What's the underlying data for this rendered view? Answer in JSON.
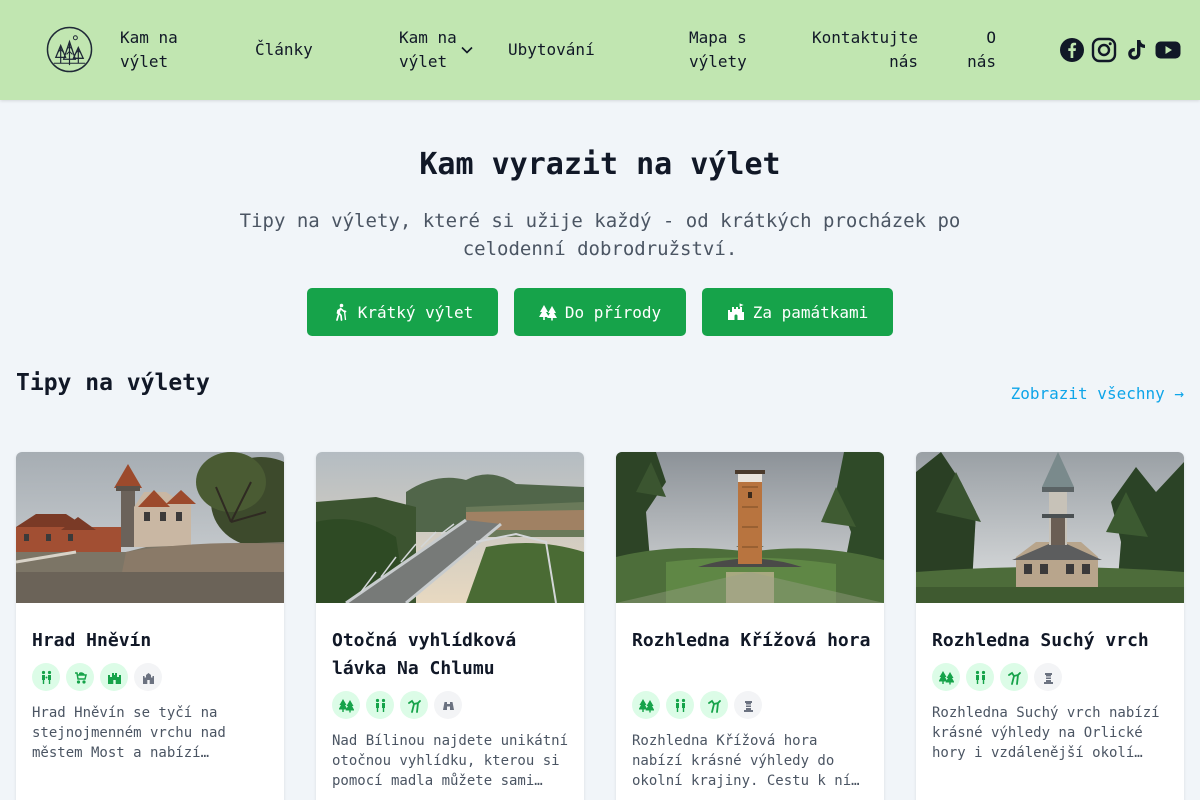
{
  "header": {
    "nav": [
      {
        "line1": "Kam na",
        "line2": "výlet"
      },
      {
        "line1": "Články",
        "line2": ""
      },
      {
        "line1": "Kam na",
        "line2": "výlet"
      },
      {
        "line1": "Ubytování",
        "line2": ""
      },
      {
        "line1": "Mapa s",
        "line2": "výlety"
      },
      {
        "line1": "Kontaktujte",
        "line2": "nás"
      },
      {
        "line1": "O",
        "line2": "nás"
      }
    ],
    "social": [
      "facebook-icon",
      "instagram-icon",
      "tiktok-icon",
      "youtube-icon"
    ]
  },
  "hero": {
    "title": "Kam vyrazit na výlet",
    "subtitle_line1": "Tipy na výlety, které si užije každý - od krátkých procházek po",
    "subtitle_line2": "celodenní dobrodružství.",
    "buttons": [
      {
        "label": "Krátký výlet",
        "icon": "hiker-icon"
      },
      {
        "label": "Do přírody",
        "icon": "trees-icon"
      },
      {
        "label": "Za památkami",
        "icon": "castle-icon"
      }
    ]
  },
  "section": {
    "title": "Tipy na výlety",
    "show_all": "Zobrazit všechny →"
  },
  "cards": [
    {
      "title": "Hrad Hněvín",
      "tags": [
        "family-icon",
        "stroller-icon",
        "castle-icon",
        "castle-icon"
      ],
      "desc": [
        "Hrad Hněvín se tyčí na",
        "stejnojmenném vrchu nad",
        "městem Most a nabízí…"
      ]
    },
    {
      "title": "Otočná vyhlídková lávka Na Chlumu",
      "tags": [
        "trees-icon",
        "family-icon",
        "bike-icon",
        "binoculars-icon"
      ],
      "desc": [
        "Nad Bílinou najdete unikátní",
        "otočnou vyhlídku, kterou si",
        "pomocí madla můžete sami…"
      ]
    },
    {
      "title": "Rozhledna Křížová hora",
      "tags": [
        "trees-icon",
        "family-icon",
        "bike-icon",
        "tower-icon"
      ],
      "desc": [
        "Rozhledna Křížová hora",
        "nabízí krásné výhledy do",
        "okolní krajiny. Cestu k ní…"
      ]
    },
    {
      "title": "Rozhledna Suchý vrch",
      "tags": [
        "trees-icon",
        "family-icon",
        "bike-icon",
        "tower-icon"
      ],
      "desc": [
        "Rozhledna Suchý vrch nabízí",
        "krásné výhledy na Orlické",
        "hory i vzdálenější okolí…"
      ]
    }
  ],
  "colors": {
    "header_bg": "#c1e6b1",
    "accent": "#16a34a",
    "link": "#0ea5e9"
  }
}
